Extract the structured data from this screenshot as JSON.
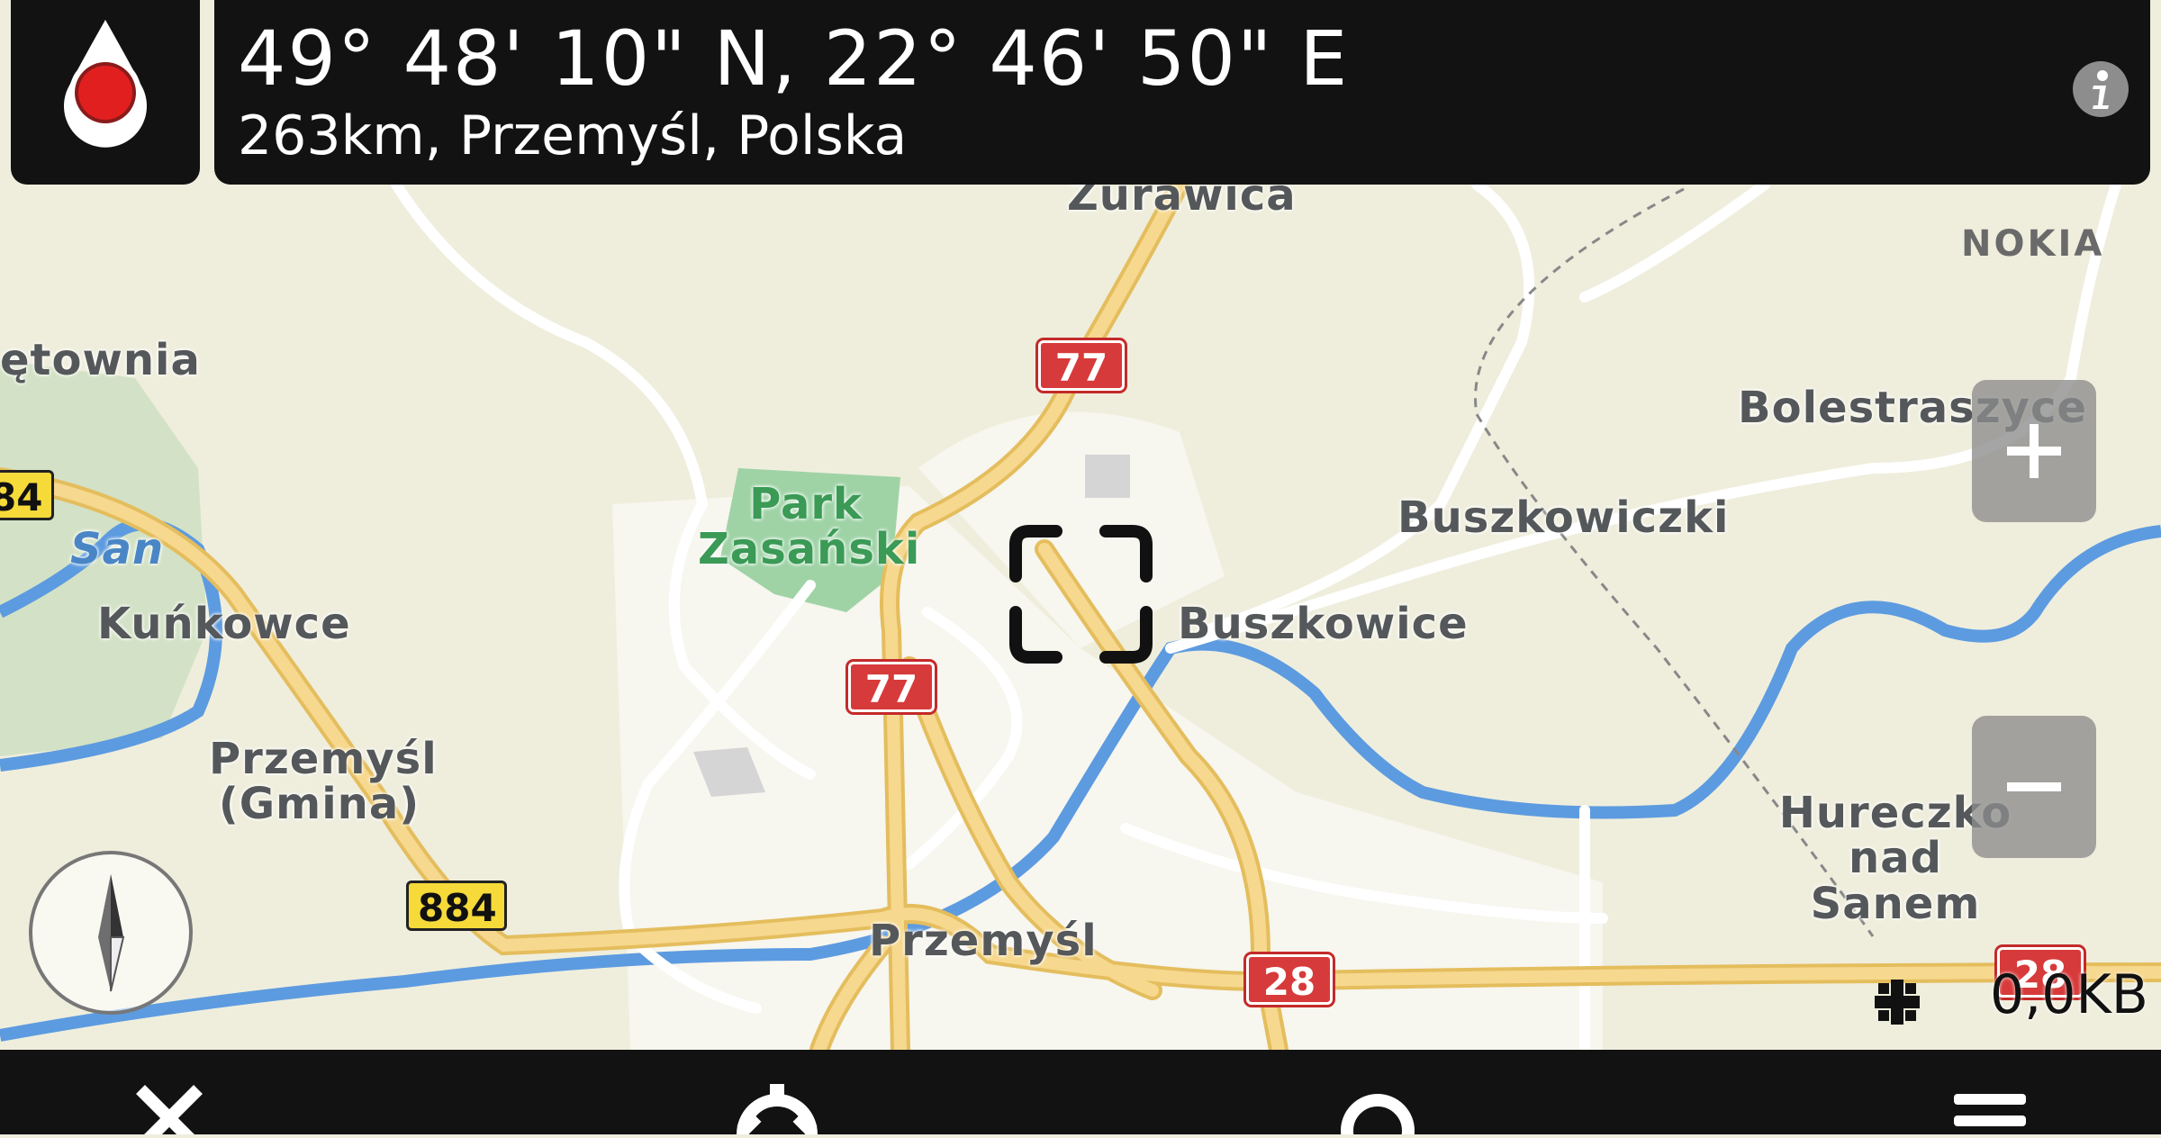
{
  "header": {
    "coordinates": "49° 48' 10\" N, 22° 46' 50\" E",
    "place": "263km, Przemyśl, Polska"
  },
  "brand": "NOKIA",
  "map_labels": {
    "zurawica": "Żurawica",
    "etownia": "ętownia",
    "bolestraszyce": "Bolestraszyce",
    "buszkowiczki": "Buszkowiczki",
    "buszkowice": "Buszkowice",
    "park": "Park Zasański",
    "san": "San",
    "kunkowce": "Kuńkowce",
    "przemysl_gmina": "Przemyśl (Gmina)",
    "hureczko": "Hureczko nad Sanem",
    "przemysl": "Przemyśl"
  },
  "road_shields": {
    "r77a": "77",
    "r77b": "77",
    "r884a": "884",
    "r884b": "84",
    "r28a": "28",
    "r28b": "28"
  },
  "status": {
    "data_usage": "0,0KB"
  },
  "colors": {
    "bar": "#121212",
    "road_major": "#f3cf78",
    "road_minor": "#ffffff",
    "water": "#5d9be0",
    "park": "#9fd3a6",
    "red_shield": "#d73a3a",
    "yellow_shield": "#f5da3a"
  },
  "icons": {
    "location": "location-pin-icon",
    "info": "info-icon",
    "zoom_in": "plus-icon",
    "zoom_out": "minus-icon",
    "compass": "compass-icon",
    "traffic": "traffic-icon",
    "close": "close-icon",
    "settings": "gear-icon",
    "search": "search-icon",
    "menu": "menu-icon"
  }
}
